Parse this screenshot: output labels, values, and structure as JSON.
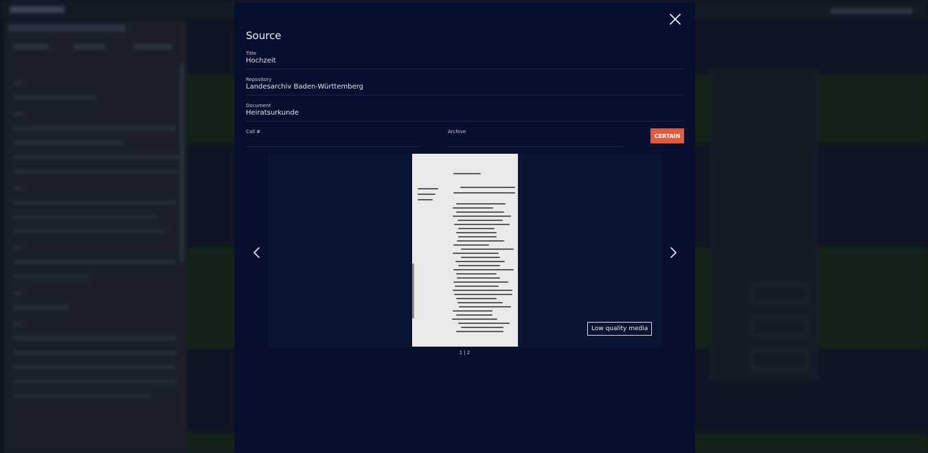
{
  "modal": {
    "title": "Source",
    "fields": {
      "title": {
        "label": "Title",
        "value": "Hochzeit"
      },
      "repository": {
        "label": "Repository",
        "value": "Landesarchiv Baden-Württemberg"
      },
      "document": {
        "label": "Document",
        "value": "Heiratsurkunde"
      },
      "call_number": {
        "label": "Call #",
        "value": ""
      },
      "archive": {
        "label": "Archive",
        "value": ""
      }
    },
    "certainty_button": "CERTAIN",
    "media": {
      "low_quality_badge": "Low quality media",
      "pager": "1 | 2"
    },
    "icons": {
      "close": "close-icon",
      "prev": "chevron-left-icon",
      "next": "chevron-right-icon"
    }
  },
  "colors": {
    "modal_bg": "#060f2e",
    "certain_button": "#e05b3b",
    "viewer_bg": "#0a1533"
  }
}
